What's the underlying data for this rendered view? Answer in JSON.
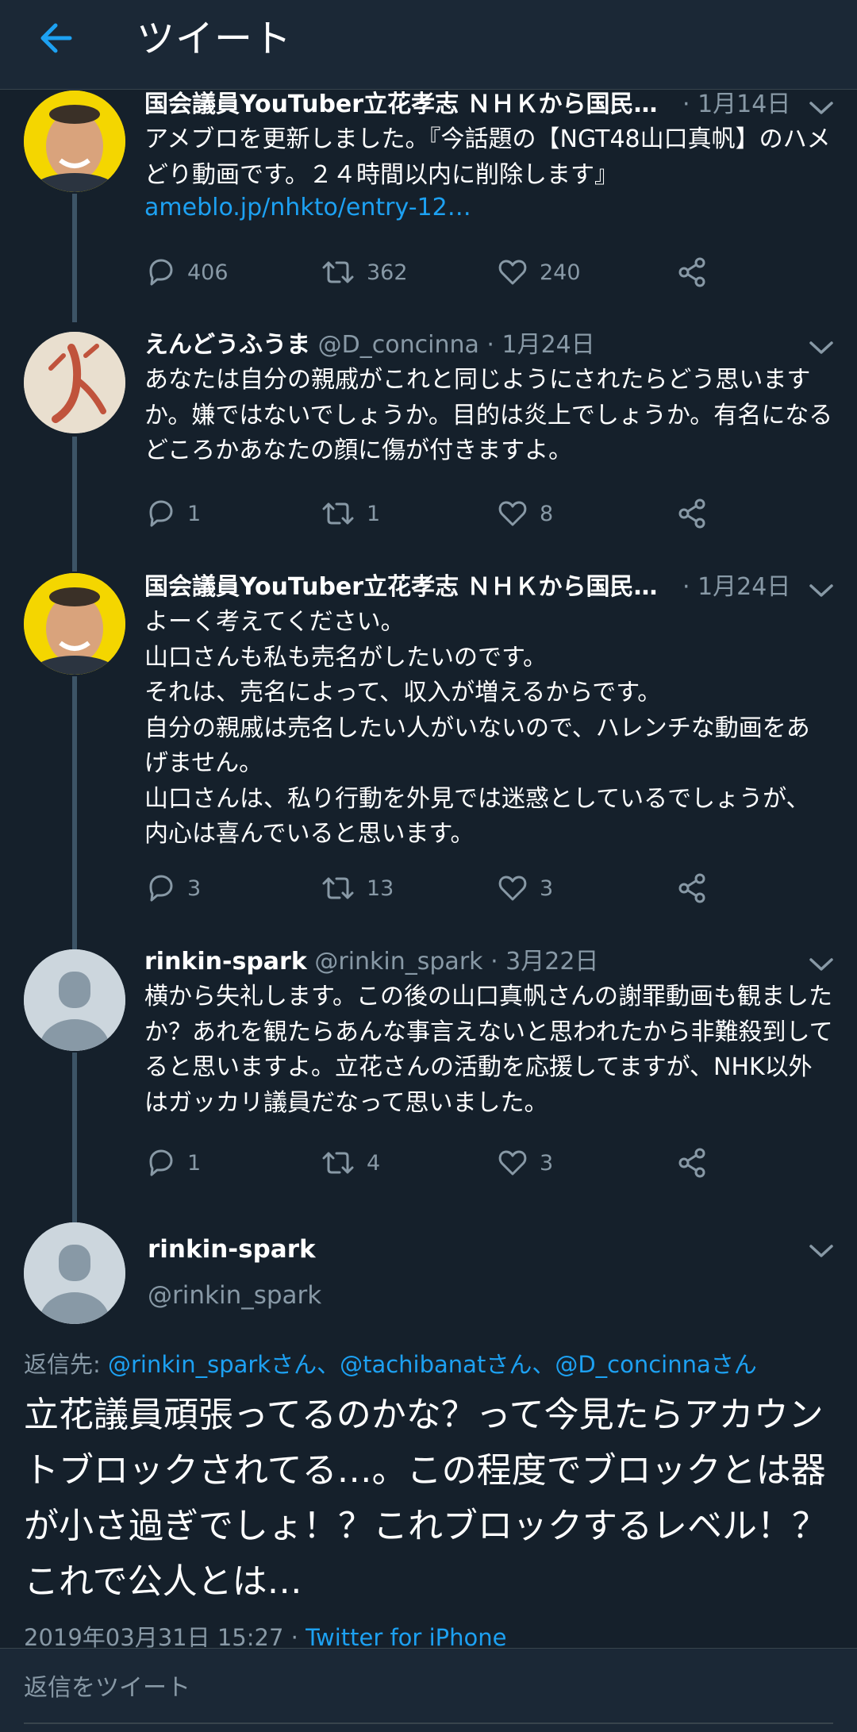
{
  "header": {
    "title": "ツイート"
  },
  "tweets": [
    {
      "name": "国会議員YouTuber立花孝志 ＮＨＫから国民…",
      "handle": "",
      "date": "· 1月14日",
      "text": "アメブロを更新しました。『今話題の【NGT48山口真帆】のハメどり動画です。２４時間以内に削除します』",
      "link": "ameblo.jp/nhkto/entry-12…",
      "replies": "406",
      "retweets": "362",
      "likes": "240"
    },
    {
      "name": "えんどうふうま",
      "handle": "@D_concinna",
      "date": "· 1月24日",
      "text": "あなたは自分の親戚がこれと同じようにされたらどう思いますか。嫌ではないでしょうか。目的は炎上でしょうか。有名になるどころかあなたの顔に傷が付きますよ。",
      "replies": "1",
      "retweets": "1",
      "likes": "8"
    },
    {
      "name": "国会議員YouTuber立花孝志 ＮＨＫから国民…",
      "handle": "",
      "date": "· 1月24日",
      "text": "よーく考えてください。\n山口さんも私も売名がしたいのです。\nそれは、売名によって、収入が増えるからです。\n自分の親戚は売名したい人がいないので、ハレンチな動画をあげません。\n山口さんは、私り行動を外見では迷惑としているでしょうが、内心は喜んでいると思います。",
      "replies": "3",
      "retweets": "13",
      "likes": "3"
    },
    {
      "name": "rinkin-spark",
      "handle": "@rinkin_spark",
      "date": "· 3月22日",
      "text": "横から失礼します。この後の山口真帆さんの謝罪動画も観ましたか？あれを観たらあんな事言えないと思われたから非難殺到してると思いますよ。立花さんの活動を応援してますが、NHK以外はガッカリ議員だなって思いました。",
      "replies": "1",
      "retweets": "4",
      "likes": "3"
    }
  ],
  "main_tweet": {
    "name": "rinkin-spark",
    "handle": "@rinkin_spark",
    "reply_prefix": "返信先: ",
    "reply_to": "@rinkin_sparkさん、@tachibanatさん、@D_concinnaさん",
    "text": "立花議員頑張ってるのかな？って今見たらアカウントブロックされてる…。この程度でブロックとは器が小さ過ぎでしょ！？これブロックするレベル！？これで公人とは…",
    "timestamp": "2019年03月31日 15:27 · ",
    "source": "Twitter for iPhone"
  },
  "reply_bar": {
    "placeholder": "返信をツイート"
  },
  "colors": {
    "background": "#15202b",
    "accent": "#1da1f2",
    "muted": "#8899a6"
  }
}
